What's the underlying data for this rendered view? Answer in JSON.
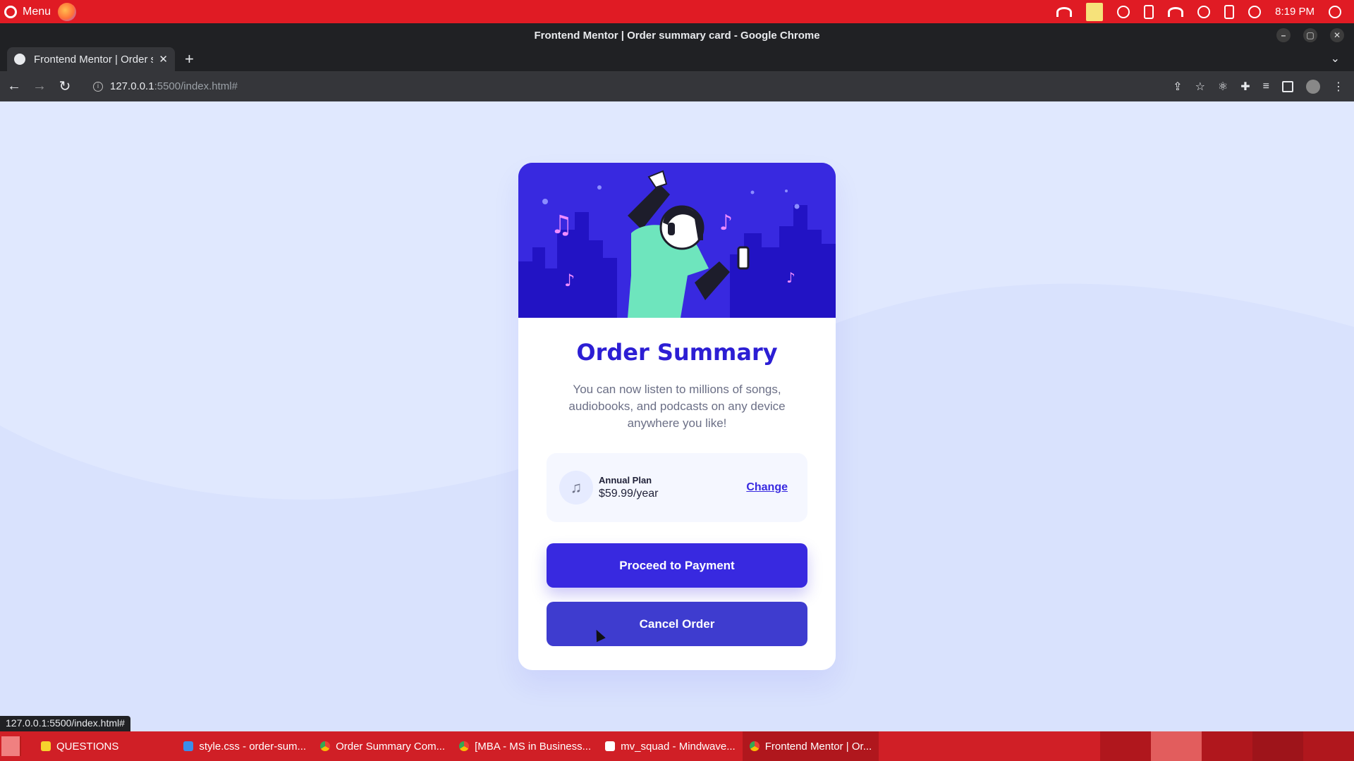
{
  "os_panel": {
    "menu_label": "Menu",
    "clock": "8:19 PM"
  },
  "window": {
    "title": "Frontend Mentor | Order summary card - Google Chrome"
  },
  "tabs": [
    {
      "label": "Frontend Mentor | Order summary card"
    }
  ],
  "address_bar": {
    "host": "127.0.0.1",
    "path": ":5500/index.html#"
  },
  "page": {
    "title": "Order Summary",
    "description": "You can now listen to millions of songs, audiobooks, and podcasts on any device anywhere you like!",
    "plan_name": "Annual Plan",
    "plan_price": "$59.99/year",
    "change_label": "Change",
    "pay_label": "Proceed to Payment",
    "cancel_label": "Cancel Order"
  },
  "status_bar_url": "127.0.0.1:5500/index.html#",
  "taskbar": {
    "items": [
      {
        "label": "QUESTIONS"
      },
      {
        "label": "style.css - order-sum..."
      },
      {
        "label": "Order Summary Com..."
      },
      {
        "label": "[MBA - MS in Business..."
      },
      {
        "label": "mv_squad - Mindwave..."
      },
      {
        "label": "Frontend Mentor | Or..."
      }
    ]
  },
  "colors": {
    "os_red": "#e01b24",
    "page_bg": "#e0e8fe",
    "brand_blue": "#3829e0",
    "card": "#ffffff"
  }
}
